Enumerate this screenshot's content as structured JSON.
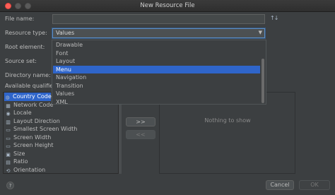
{
  "window": {
    "title": "New Resource File"
  },
  "form": {
    "file_name_label": "File name:",
    "file_name_value": "",
    "sort_icon": "sort-icon",
    "resource_type_label": "Resource type:",
    "resource_type_value": "Values",
    "root_element_label": "Root element:",
    "source_set_label": "Source set:",
    "directory_name_label": "Directory name:",
    "available_qualifiers_label": "Available qualifie"
  },
  "dropdown": {
    "options": [
      "Drawable",
      "Font",
      "Layout",
      "Menu",
      "Navigation",
      "Transition",
      "Values",
      "XML"
    ],
    "highlighted": "Menu"
  },
  "qualifiers": [
    {
      "label": "Country Code",
      "icon": "globe-icon",
      "selected": true
    },
    {
      "label": "Network Code",
      "icon": "network-icon",
      "selected": false
    },
    {
      "label": "Locale",
      "icon": "locale-icon",
      "selected": false
    },
    {
      "label": "Layout Direction",
      "icon": "direction-icon",
      "selected": false
    },
    {
      "label": "Smallest Screen Width",
      "icon": "screen-icon",
      "selected": false
    },
    {
      "label": "Screen Width",
      "icon": "screen-icon",
      "selected": false
    },
    {
      "label": "Screen Height",
      "icon": "screen-icon",
      "selected": false
    },
    {
      "label": "Size",
      "icon": "size-icon",
      "selected": false
    },
    {
      "label": "Ratio",
      "icon": "ratio-icon",
      "selected": false
    },
    {
      "label": "Orientation",
      "icon": "orientation-icon",
      "selected": false
    }
  ],
  "chosen": {
    "empty_text": "Nothing to show"
  },
  "buttons": {
    "add": ">>",
    "remove": "<<",
    "help": "?",
    "cancel": "Cancel",
    "ok": "OK"
  },
  "colors": {
    "selection": "#2f65ca",
    "background": "#3c3f41",
    "close_button": "#fe5f57"
  }
}
